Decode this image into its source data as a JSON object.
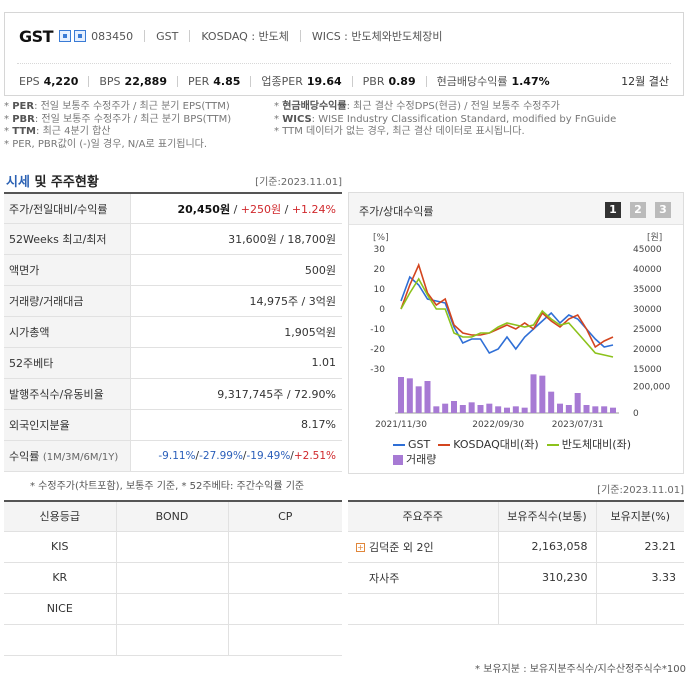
{
  "header": {
    "name": "GST",
    "code": "083450",
    "meta": [
      "GST",
      "KOSDAQ : 반도체",
      "WICS : 반도체와반도체장비"
    ],
    "metrics": [
      {
        "label": "EPS",
        "value": "4,220"
      },
      {
        "label": "BPS",
        "value": "22,889"
      },
      {
        "label": "PER",
        "value": "4.85"
      },
      {
        "label": "업종PER",
        "value": "19.64"
      },
      {
        "label": "PBR",
        "value": "0.89"
      },
      {
        "label": "현금배당수익률",
        "value": "1.47%"
      }
    ],
    "fiscal": "12월 결산"
  },
  "notes": {
    "left": [
      {
        "k": "PER",
        "t": ": 전일 보통주 수정주가 / 최근 분기 EPS(TTM)"
      },
      {
        "k": "PBR",
        "t": ": 전일 보통주 수정주가 / 최근 분기 BPS(TTM)"
      },
      {
        "k": "TTM",
        "t": ": 최근 4분기 합산"
      },
      {
        "k": "",
        "t": "PER, PBR값이 (-)일 경우, N/A로 표기됩니다."
      }
    ],
    "right": [
      {
        "k": "현금배당수익률",
        "t": ": 최근 결산 수정DPS(현금) / 전일 보통주 수정주가"
      },
      {
        "k": "WICS",
        "t": ": WISE Industry Classification Standard, modified by FnGuide"
      },
      {
        "k": "",
        "t": "TTM 데이터가 없는 경우, 최근 결산 데이터로 표시됩니다."
      }
    ]
  },
  "section": {
    "title_hi": "시세",
    "title_rest": " 및 주주현황",
    "date": "[기준:2023.11.01]"
  },
  "market": {
    "rows": [
      {
        "k": "주가/전일대비/수익률",
        "price": "20,450원",
        "chg": "+250원",
        "pct": "+1.24%"
      },
      {
        "k": "52Weeks 최고/최저",
        "v": "31,600원 / 18,700원"
      },
      {
        "k": "액면가",
        "v": "500원"
      },
      {
        "k": "거래량/거래대금",
        "v": "14,975주 / 3억원"
      },
      {
        "k": "시가총액",
        "v": "1,905억원"
      },
      {
        "k": "52주베타",
        "v": "1.01"
      },
      {
        "k": "발행주식수/유동비율",
        "v": "9,317,745주 / 72.90%"
      },
      {
        "k": "외국인지분율",
        "v": "8.17%"
      },
      {
        "k": "수익률",
        "k2": "(1M/3M/6M/1Y)",
        "r": [
          "-9.11%",
          "-27.99%",
          "-19.49%",
          "+2.51%"
        ]
      }
    ],
    "footnote": "* 수정주가(차트포함), 보통주 기준, * 52주베타: 주간수익률 기준"
  },
  "chart_panel": {
    "title": "주가/상대수익률",
    "tabs": [
      "1",
      "2",
      "3"
    ],
    "y_left_unit": "[%]",
    "y_right_unit": "[원]"
  },
  "chart_data": {
    "type": "line",
    "x_ticks": [
      "2021/11/30",
      "2022/09/30",
      "2023/07/31"
    ],
    "y_left": {
      "ticks": [
        30,
        20,
        10,
        0,
        -10,
        -20,
        -30
      ],
      "range": [
        -30,
        30
      ]
    },
    "y_right": {
      "ticks": [
        45000,
        40000,
        35000,
        30000,
        25000,
        20000,
        15000
      ],
      "range": [
        15000,
        45000
      ]
    },
    "volume_axis": {
      "ticks": [
        "200,000",
        "0"
      ],
      "range": [
        0,
        300000
      ]
    },
    "series": [
      {
        "name": "GST",
        "color": "#2f6fd6",
        "values": [
          4,
          16,
          12,
          5,
          4,
          3,
          -9,
          -17,
          -15,
          -15,
          -22,
          -20,
          -14,
          -20,
          -14,
          -10,
          -6,
          -2,
          -7,
          -3,
          -5,
          -10,
          -15,
          -19,
          -18
        ]
      },
      {
        "name": "KOSDAQ대비(좌)",
        "color": "#d3451f",
        "values": [
          0,
          12,
          22,
          8,
          2,
          5,
          -8,
          -12,
          -13,
          -13,
          -12,
          -10,
          -8,
          -10,
          -7,
          -10,
          -2,
          -6,
          -9,
          -5,
          -3,
          -10,
          -19,
          -16,
          -14
        ]
      },
      {
        "name": "반도체대비(좌)",
        "color": "#8cc21c",
        "values": [
          0,
          8,
          15,
          7,
          0,
          0,
          -12,
          -14,
          -14,
          -12,
          -12,
          -9,
          -7,
          -8,
          -9,
          -8,
          -1,
          -5,
          -8,
          -7,
          -12,
          -17,
          -22,
          -23,
          -24
        ]
      },
      {
        "name": "거래량",
        "type": "bar",
        "color": "#a77ad4",
        "values": [
          270000,
          260000,
          200000,
          240000,
          50000,
          70000,
          90000,
          60000,
          80000,
          60000,
          70000,
          50000,
          40000,
          50000,
          40000,
          290000,
          280000,
          160000,
          70000,
          60000,
          150000,
          60000,
          50000,
          50000,
          40000
        ]
      }
    ]
  },
  "credit": {
    "headers": [
      "신용등급",
      "BOND",
      "CP"
    ],
    "rows": [
      [
        "KIS",
        "",
        ""
      ],
      [
        "KR",
        "",
        ""
      ],
      [
        "NICE",
        "",
        ""
      ],
      [
        "",
        "",
        ""
      ]
    ]
  },
  "holders": {
    "date": "[기준:2023.11.01]",
    "headers": [
      "주요주주",
      "보유주식수(보통)",
      "보유지분(%)"
    ],
    "rows": [
      {
        "name": "김덕준 외 2인",
        "expand": true,
        "shares": "2,163,058",
        "pct": "23.21"
      },
      {
        "name": "자사주",
        "expand": false,
        "shares": "310,230",
        "pct": "3.33"
      },
      {
        "name": "",
        "expand": false,
        "shares": "",
        "pct": ""
      }
    ],
    "footnote": "* 보유지분 : 보유지분주식수/지수산정주식수*100"
  }
}
